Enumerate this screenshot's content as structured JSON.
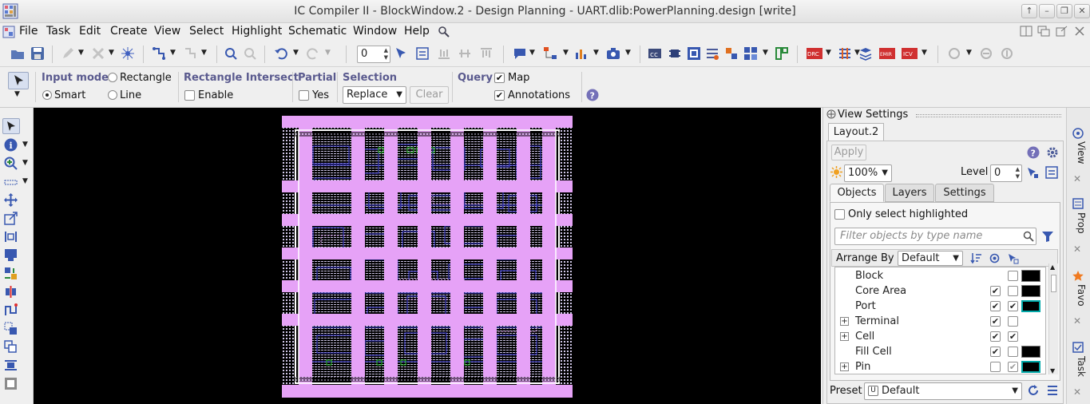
{
  "window": {
    "title": "IC Compiler II - BlockWindow.2 - Design Planning - UART.dlib:PowerPlanning.design [write]"
  },
  "menu": [
    "File",
    "Task",
    "Edit",
    "Create",
    "View",
    "Select",
    "Highlight",
    "Schematic",
    "Window",
    "Help"
  ],
  "toolbar": {
    "spin_value": "0"
  },
  "options": {
    "input_mode": {
      "title": "Input mode",
      "opt1": "Rectangle",
      "opt2": "Smart",
      "opt3": "Line",
      "selected": "Smart"
    },
    "rect_intersect": {
      "title": "Rectangle Intersect",
      "enable": "Enable"
    },
    "partial": {
      "title": "Partial",
      "yes": "Yes"
    },
    "selection": {
      "title": "Selection",
      "mode": "Replace",
      "clear": "Clear"
    },
    "query": {
      "title": "Query",
      "map": "Map",
      "annotations": "Annotations"
    }
  },
  "view_settings": {
    "header": "View Settings",
    "doc_tab": "Layout.2",
    "apply": "Apply",
    "zoom": "100%",
    "level_label": "Level",
    "level_value": "0",
    "tabs": [
      "Objects",
      "Layers",
      "Settings"
    ],
    "only_highlighted": "Only select highlighted",
    "filter_placeholder": "Filter objects by type name",
    "arrange_label": "Arrange By",
    "arrange_value": "Default",
    "rows": [
      {
        "name": "Block",
        "expandable": false,
        "visible": false,
        "selectable": false,
        "swatch": "#000000"
      },
      {
        "name": "Core Area",
        "expandable": false,
        "visible": true,
        "selectable": false,
        "swatch": "#000000"
      },
      {
        "name": "Port",
        "expandable": false,
        "visible": true,
        "selectable": true,
        "swatch": "#00a8a8"
      },
      {
        "name": "Terminal",
        "expandable": true,
        "visible": true,
        "selectable": false,
        "swatch": null
      },
      {
        "name": "Cell",
        "expandable": true,
        "visible": true,
        "selectable": true,
        "swatch": null
      },
      {
        "name": "Fill Cell",
        "expandable": false,
        "visible": true,
        "selectable": false,
        "swatch": "#000000"
      },
      {
        "name": "Pin",
        "expandable": true,
        "visible": false,
        "selectable": true,
        "swatch": "#00a8a8"
      }
    ],
    "preset_label": "Preset",
    "preset_value": "Default"
  },
  "side_tabs": [
    "View",
    "Prop",
    "Favo",
    "Task"
  ],
  "colors": {
    "stripe": "#e6a2f7",
    "wire": "#3c3cdc",
    "pin": "#22c022",
    "canvas_bg": "#000000",
    "accent": "#5a5a8e"
  }
}
